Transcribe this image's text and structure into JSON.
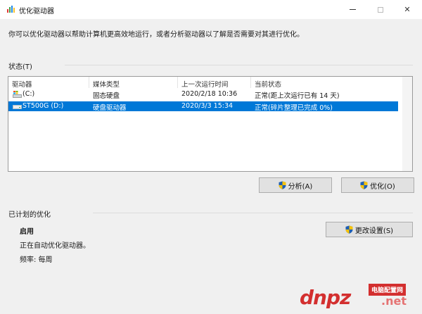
{
  "window": {
    "title": "优化驱动器",
    "icon": "defrag-app-icon"
  },
  "description": "你可以优化驱动器以帮助计算机更高效地运行，或者分析驱动器以了解是否需要对其进行优化。",
  "status": {
    "group_label": "状态(T)",
    "columns": [
      "驱动器",
      "媒体类型",
      "上一次运行时间",
      "当前状态"
    ],
    "rows": [
      {
        "drive": "(C:)",
        "media": "固态硬盘",
        "last_run": "2020/2/18 10:36",
        "state": "正常(距上次运行已有 14 天)",
        "selected": false,
        "icon": "windows-drive-icon"
      },
      {
        "drive": "ST500G (D:)",
        "media": "硬盘驱动器",
        "last_run": "2020/3/3 15:34",
        "state": "正常(碎片整理已完成 0%)",
        "selected": true,
        "icon": "hard-drive-icon"
      }
    ]
  },
  "buttons": {
    "analyze": "分析(A)",
    "optimize": "优化(O)",
    "change_settings": "更改设置(S)"
  },
  "scheduled": {
    "group_label": "已计划的优化",
    "state": "启用",
    "detail": "正在自动优化驱动器。",
    "frequency": "频率: 每周"
  },
  "watermark": {
    "logo": "dnpz",
    "tag": "电脑配置网",
    "suffix": ".net"
  },
  "colors": {
    "selection": "#0078d7",
    "shield_blue": "#1e5fb4",
    "shield_yellow": "#f4c20d",
    "watermark_red": "#d32f2f"
  }
}
